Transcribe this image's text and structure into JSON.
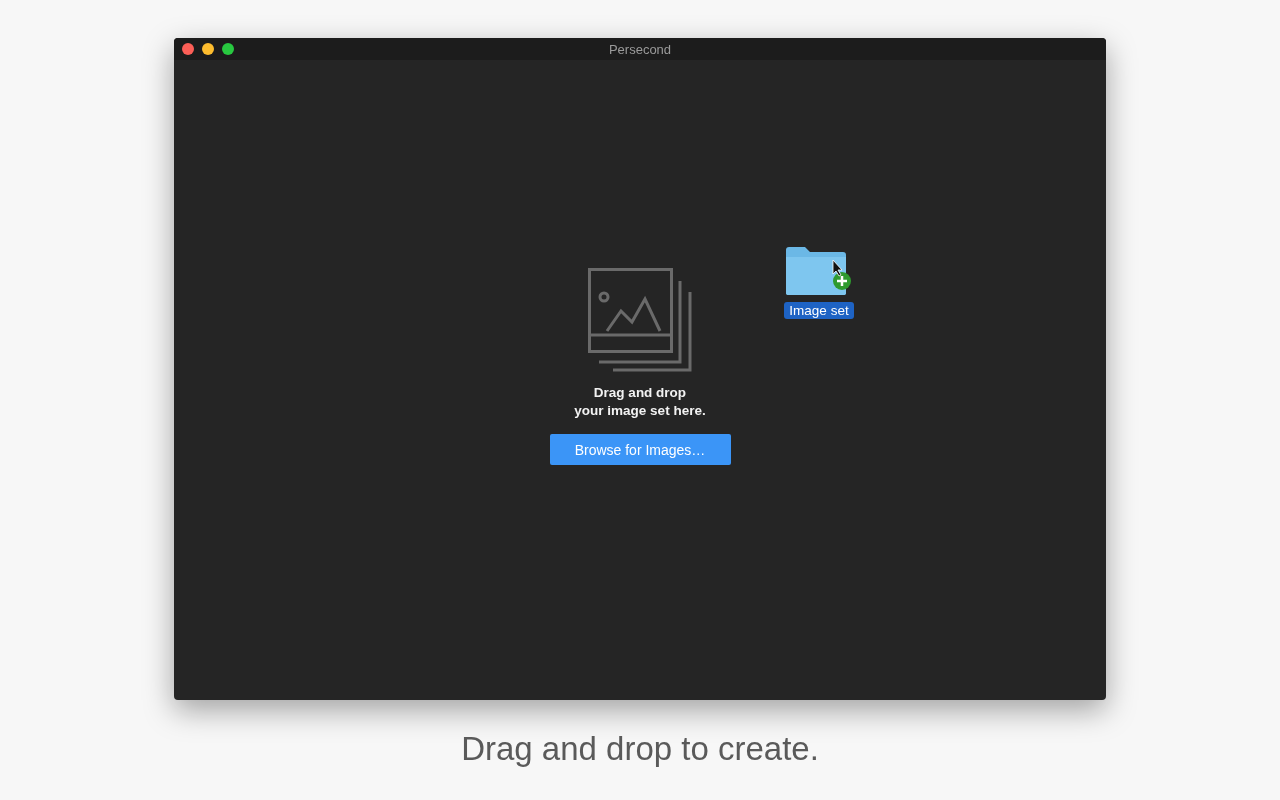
{
  "window": {
    "title": "Persecond"
  },
  "drop_zone": {
    "message_lines": [
      "Drag and drop",
      "your image set here."
    ],
    "button": "Browse for Images…"
  },
  "dragged_item": {
    "label": "Image set",
    "selected": true
  },
  "caption": "Drag and drop to create."
}
